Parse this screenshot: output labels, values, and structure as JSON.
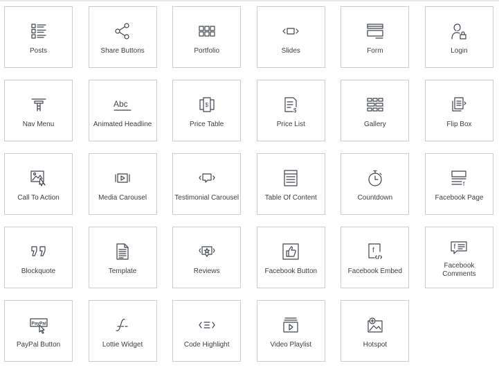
{
  "widgets": [
    {
      "label": "Posts",
      "icon": "posts-icon"
    },
    {
      "label": "Share Buttons",
      "icon": "share-icon"
    },
    {
      "label": "Portfolio",
      "icon": "portfolio-grid-icon"
    },
    {
      "label": "Slides",
      "icon": "slides-icon"
    },
    {
      "label": "Form",
      "icon": "form-icon"
    },
    {
      "label": "Login",
      "icon": "login-user-lock-icon"
    },
    {
      "label": "Nav Menu",
      "icon": "nav-menu-icon"
    },
    {
      "label": "Animated Headline",
      "icon": "animated-headline-icon"
    },
    {
      "label": "Price Table",
      "icon": "price-table-icon"
    },
    {
      "label": "Price List",
      "icon": "price-list-icon"
    },
    {
      "label": "Gallery",
      "icon": "gallery-icon"
    },
    {
      "label": "Flip Box",
      "icon": "flip-box-icon"
    },
    {
      "label": "Call To Action",
      "icon": "call-to-action-icon"
    },
    {
      "label": "Media Carousel",
      "icon": "media-carousel-icon"
    },
    {
      "label": "Testimonial Carousel",
      "icon": "testimonial-carousel-icon"
    },
    {
      "label": "Table Of Content",
      "icon": "table-of-content-icon"
    },
    {
      "label": "Countdown",
      "icon": "stopwatch-icon"
    },
    {
      "label": "Facebook Page",
      "icon": "facebook-page-icon"
    },
    {
      "label": "Blockquote",
      "icon": "blockquote-icon"
    },
    {
      "label": "Template",
      "icon": "template-document-icon"
    },
    {
      "label": "Reviews",
      "icon": "reviews-star-icon"
    },
    {
      "label": "Facebook Button",
      "icon": "facebook-like-icon"
    },
    {
      "label": "Facebook Embed",
      "icon": "facebook-embed-icon"
    },
    {
      "label": "Facebook Comments",
      "icon": "facebook-comments-icon"
    },
    {
      "label": "PayPal Button",
      "icon": "paypal-button-icon"
    },
    {
      "label": "Lottie Widget",
      "icon": "lottie-icon"
    },
    {
      "label": "Code Highlight",
      "icon": "code-highlight-icon"
    },
    {
      "label": "Video Playlist",
      "icon": "video-playlist-icon"
    },
    {
      "label": "Hotspot",
      "icon": "hotspot-icon"
    }
  ],
  "paypal_icon_text": "PayPal",
  "abc_icon_text": "Abc"
}
